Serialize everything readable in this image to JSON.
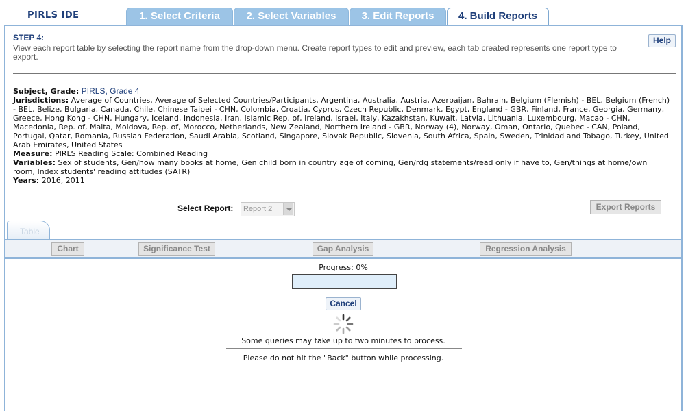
{
  "app": {
    "logo": "PIRLS IDE"
  },
  "tabs": [
    {
      "label": "1. Select Criteria",
      "active": false
    },
    {
      "label": "2. Select Variables",
      "active": false
    },
    {
      "label": "3. Edit Reports",
      "active": false
    },
    {
      "label": "4. Build Reports",
      "active": true
    }
  ],
  "step": {
    "title": "STEP 4:",
    "description": "View each report table by selecting the report name from the drop-down menu. Create report types to edit and preview, each tab created represents one report type to export.",
    "help_label": "Help"
  },
  "info": {
    "subject_label": "Subject, Grade:",
    "subject_value": "PIRLS, Grade 4",
    "jurisdictions_label": "Jurisdictions:",
    "jurisdictions_value": "Average of Countries, Average of Selected Countries/Participants, Argentina, Australia, Austria, Azerbaijan, Bahrain, Belgium (Flemish) - BEL, Belgium (French) - BEL, Belize, Bulgaria, Canada, Chile, Chinese Taipei - CHN, Colombia, Croatia, Cyprus, Czech Republic, Denmark, Egypt, England - GBR, Finland, France, Georgia, Germany, Greece, Hong Kong - CHN, Hungary, Iceland, Indonesia, Iran, Islamic Rep. of, Ireland, Israel, Italy, Kazakhstan, Kuwait, Latvia, Lithuania, Luxembourg, Macao - CHN, Macedonia, Rep. of, Malta, Moldova, Rep. of, Morocco, Netherlands, New Zealand, Northern Ireland - GBR, Norway (4), Norway, Oman, Ontario, Quebec - CAN, Poland, Portugal, Qatar, Romania, Russian Federation, Saudi Arabia, Scotland, Singapore, Slovak Republic, Slovenia, South Africa, Spain, Sweden, Trinidad and Tobago, Turkey, United Arab Emirates, United States",
    "measure_label": "Measure:",
    "measure_value": "PIRLS Reading Scale: Combined Reading",
    "variables_label": "Variables:",
    "variables_value": "Sex of students, Gen/how many books at home, Gen child born in country age of coming, Gen/rdg statements/read only if have to, Gen/things at home/own room, Index students' reading attitudes (SATR)",
    "years_label": "Years:",
    "years_value": "2016, 2011"
  },
  "report": {
    "select_label": "Select Report:",
    "selected": "Report 2",
    "export_label": "Export Reports"
  },
  "report_tabs": [
    {
      "label": "Table"
    }
  ],
  "toolbar": {
    "chart": "Chart",
    "significance": "Significance Test",
    "gap": "Gap Analysis",
    "regression": "Regression Analysis"
  },
  "progress": {
    "text": "Progress: 0%",
    "value": 0,
    "cancel_label": "Cancel",
    "note1": "Some queries may take up to two minutes to process.",
    "note2": "Please do not hit the \"Back\" button while processing."
  }
}
